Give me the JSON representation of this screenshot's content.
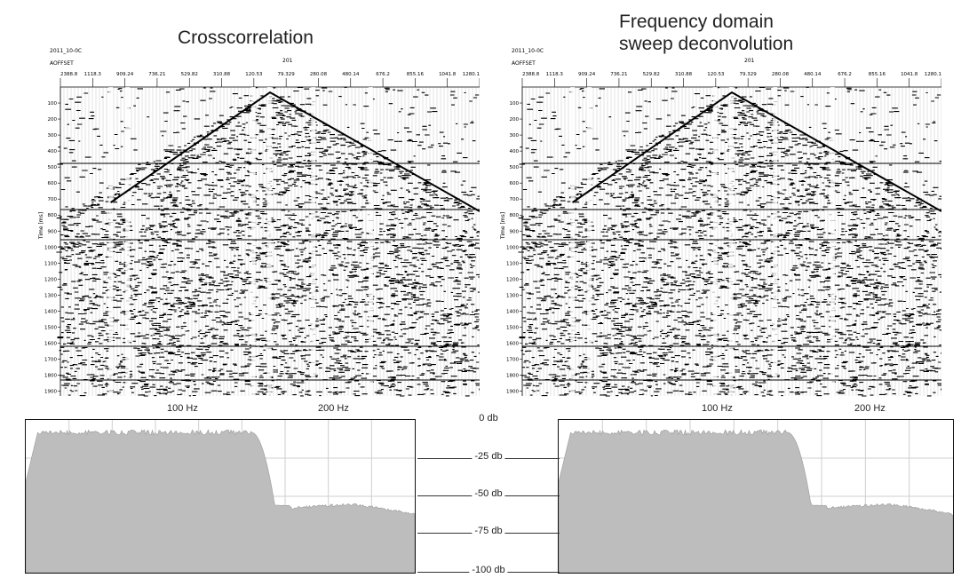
{
  "panels": [
    {
      "title_lines": [
        "Crosscorrelation"
      ],
      "header_id": "2011_10-0C",
      "header_label": "AOFFSET",
      "shot_marker": "201",
      "offset_ticks": [
        "2388.8",
        "1118.3",
        "909.24",
        "736.21",
        "529.82",
        "310.88",
        "120.53",
        "79.329",
        "280.08",
        "480.14",
        "676.2",
        "855.16",
        "1041.8",
        "1280.1"
      ],
      "time_axis_label": "Time [ms]",
      "time_ticks": [
        "100",
        "200",
        "300",
        "400",
        "500",
        "600",
        "700",
        "800",
        "900",
        "1000",
        "1100",
        "1200",
        "1300",
        "1400",
        "1500",
        "1600",
        "1700",
        "1800",
        "1900"
      ],
      "freq_labels": [
        "100 Hz",
        "200 Hz"
      ]
    },
    {
      "title_lines": [
        "Frequency domain",
        "sweep deconvolution"
      ],
      "header_id": "2011_10-0C",
      "header_label": "AOFFSET",
      "shot_marker": "201",
      "offset_ticks": [
        "2388.8",
        "1118.3",
        "909.24",
        "736.21",
        "529.82",
        "310.88",
        "120.53",
        "79.329",
        "280.08",
        "480.14",
        "676.2",
        "855.16",
        "1041.8",
        "1280.1"
      ],
      "time_axis_label": "Time [ms]",
      "time_ticks": [
        "100",
        "200",
        "300",
        "400",
        "500",
        "600",
        "700",
        "800",
        "900",
        "1000",
        "1100",
        "1200",
        "1300",
        "1400",
        "1500",
        "1600",
        "1700",
        "1800",
        "1900"
      ],
      "freq_labels": [
        "100 Hz",
        "200 Hz"
      ]
    }
  ],
  "db_scale": [
    "0 db",
    "-25 db",
    "-50 db",
    "-75 db",
    "-100 db"
  ],
  "colors": {
    "spectrum_fill": "#bdbdbd",
    "seismic_ink": "#000000",
    "grid": "#cfcfcf"
  }
}
